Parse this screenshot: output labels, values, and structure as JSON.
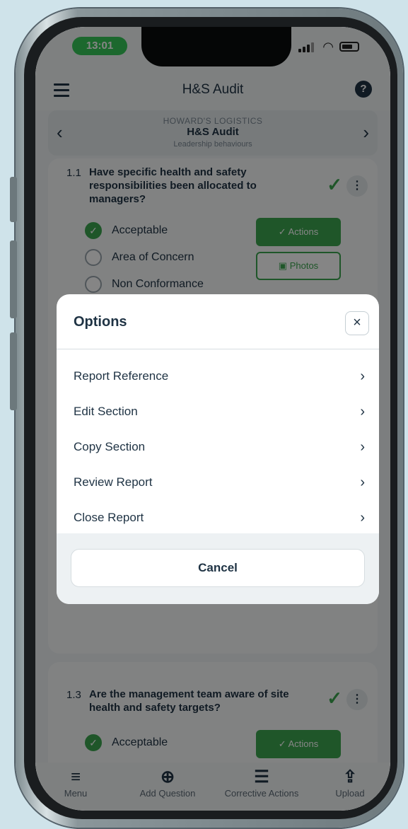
{
  "status": {
    "time": "13:01"
  },
  "header": {
    "title": "H&S Audit",
    "help": "?"
  },
  "report": {
    "company": "HOWARD'S LOGISTICS",
    "title": "H&S Audit",
    "section": "Leadership behaviours"
  },
  "q1": {
    "number": "1.1",
    "text": "Have specific health and safety responsibilities been allocated to managers?",
    "options": [
      "Acceptable",
      "Area of Concern",
      "Non Conformance"
    ],
    "selected": "Acceptable",
    "actions_label": "Actions",
    "photos_label": "Photos"
  },
  "q3": {
    "number": "1.3",
    "text": "Are the management team aware of site health and safety targets?",
    "first_option": "Acceptable",
    "actions_label": "Actions"
  },
  "modal": {
    "title": "Options",
    "items": [
      "Report Reference",
      "Edit Section",
      "Copy Section",
      "Review Report",
      "Close Report"
    ],
    "cancel": "Cancel"
  },
  "bottom_nav": [
    {
      "label": "Menu",
      "icon": "menu-icon"
    },
    {
      "label": "Add Question",
      "icon": "add-circle-icon"
    },
    {
      "label": "Corrective Actions",
      "icon": "checklist-icon"
    },
    {
      "label": "Upload",
      "icon": "upload-icon"
    }
  ],
  "colors": {
    "accent": "#3ca650",
    "navy": "#1f3344",
    "time_pill": "#37c759"
  }
}
